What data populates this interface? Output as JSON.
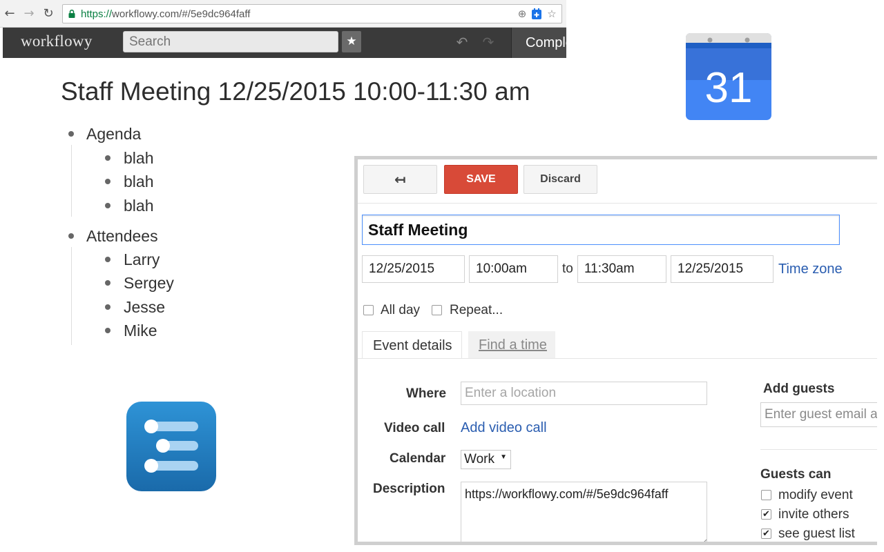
{
  "browser": {
    "url_scheme": "https://",
    "url_rest": "workflowy.com/#/5e9dc964faff",
    "icons": [
      "back-arrow-icon",
      "forward-arrow-icon",
      "reload-icon",
      "lock-icon",
      "zoom-icon",
      "extension-icon",
      "bookmark-star-icon"
    ]
  },
  "workflowy": {
    "logo": "workflowy",
    "search_placeholder": "Search",
    "complete_label": "Completed",
    "page_title": "Staff Meeting 12/25/2015 10:00-11:30 am",
    "outline": [
      {
        "label": "Agenda",
        "children": [
          "blah",
          "blah",
          "blah"
        ]
      },
      {
        "label": "Attendees",
        "children": [
          "Larry",
          "Sergey",
          "Jesse",
          "Mike"
        ]
      }
    ]
  },
  "gcal": {
    "icon_day": "31",
    "toolbar": {
      "save_label": "SAVE",
      "discard_label": "Discard"
    },
    "title_value": "Staff Meeting",
    "start_date": "12/25/2015",
    "start_time": "10:00am",
    "to_label": "to",
    "end_time": "11:30am",
    "end_date": "12/25/2015",
    "timezone_label": "Time zone",
    "allday_label": "All day",
    "repeat_label": "Repeat...",
    "tabs": {
      "details": "Event details",
      "find_time": "Find a time"
    },
    "where_label": "Where",
    "where_placeholder": "Enter a location",
    "video_label": "Video call",
    "video_link": "Add video call",
    "calendar_label": "Calendar",
    "calendar_value": "Work",
    "description_label": "Description",
    "description_value": "https://workflowy.com/#/5e9dc964faff",
    "add_guests_label": "Add guests",
    "guest_placeholder": "Enter guest email addresses",
    "guests_can_label": "Guests can",
    "permissions": [
      {
        "label": "modify event",
        "checked": false
      },
      {
        "label": "invite others",
        "checked": true
      },
      {
        "label": "see guest list",
        "checked": true
      }
    ],
    "colors": {
      "save": "#d84a38",
      "link": "#2a5db0",
      "focus": "#4d90fe"
    }
  }
}
